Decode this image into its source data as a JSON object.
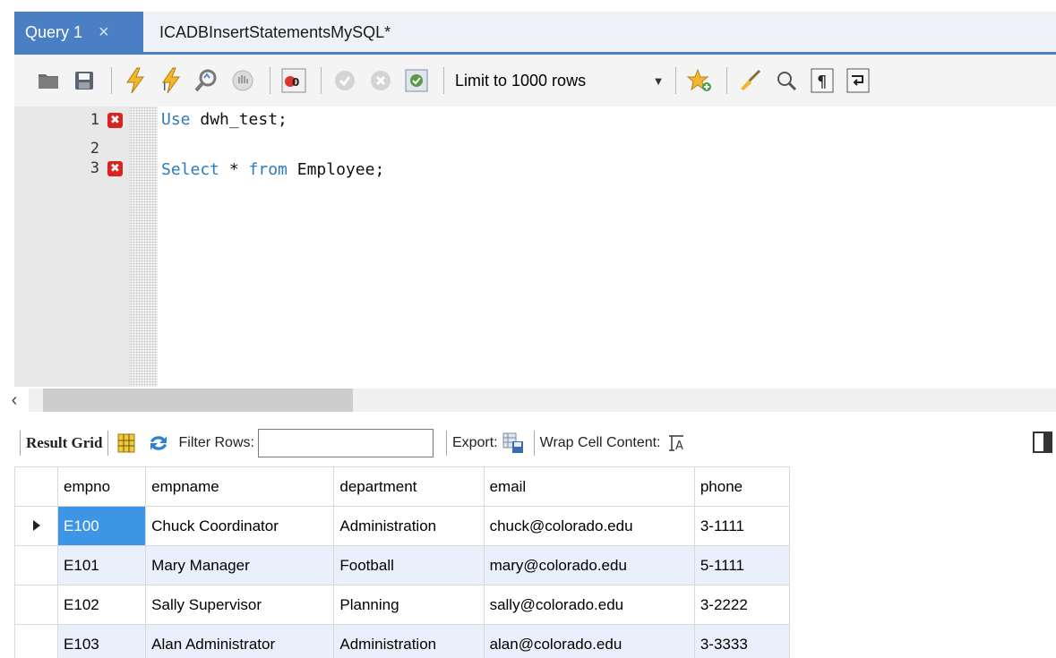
{
  "tabs": [
    {
      "label": "Query 1",
      "close": "×"
    },
    {
      "label": "ICADBInsertStatementsMySQL*"
    }
  ],
  "toolbar": {
    "icons": [
      "open-folder-icon",
      "save-icon",
      "execute-icon",
      "execute-current-icon",
      "explain-icon",
      "stop-icon",
      "toggle-error-icon",
      "commit-icon",
      "rollback-icon",
      "autocommit-icon",
      "bookmark-icon",
      "beautify-icon",
      "find-icon",
      "invisible-chars-icon",
      "wrap-icon"
    ],
    "limit_label": "Limit to 1000 rows"
  },
  "editor": {
    "lines": [
      {
        "num": "1",
        "error": true,
        "keyword": "Use",
        "rest": " dwh_test;"
      },
      {
        "num": "2",
        "error": false,
        "keyword": "",
        "rest": ""
      },
      {
        "num": "3",
        "error": true,
        "keyword": "Select",
        "rest_mid": " * ",
        "keyword2": "from",
        "rest": " Employee;"
      }
    ],
    "error_glyph": "✖"
  },
  "scroll": {
    "left_arrow": "‹"
  },
  "result_toolbar": {
    "result_grid": "Result Grid",
    "filter_rows": "Filter Rows:",
    "filter_value": "",
    "export": "Export:",
    "wrap": "Wrap Cell Content:"
  },
  "grid": {
    "columns": [
      "empno",
      "empname",
      "department",
      "email",
      "phone"
    ],
    "rows": [
      [
        "E100",
        "Chuck Coordinator",
        "Administration",
        "chuck@colorado.edu",
        "3-1111"
      ],
      [
        "E101",
        "Mary Manager",
        "Football",
        "mary@colorado.edu",
        "5-1111"
      ],
      [
        "E102",
        "Sally Supervisor",
        "Planning",
        "sally@colorado.edu",
        "3-2222"
      ],
      [
        "E103",
        "Alan Administrator",
        "Administration",
        "alan@colorado.edu",
        "3-3333"
      ]
    ]
  },
  "colors": {
    "accent": "#4a7fc4",
    "keyword": "#2b7bbd",
    "selection": "#3d95e6",
    "alt_row": "#e9f0fb",
    "error": "#d9231f"
  }
}
